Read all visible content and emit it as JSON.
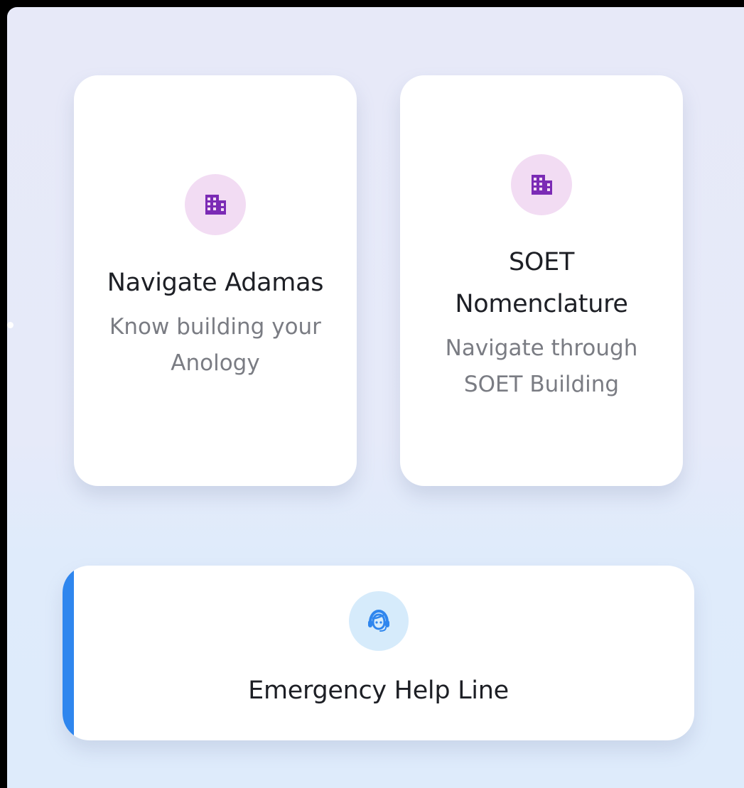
{
  "cards": [
    {
      "title": "Navigate Adamas",
      "subtitle": "Know building your Anology",
      "icon": "building-icon",
      "icon_color": "#7b2bb5",
      "icon_bg": "#f2dcf3"
    },
    {
      "title": "SOET Nomenclature",
      "subtitle": "Navigate through SOET Building",
      "icon": "building-icon",
      "icon_color": "#7b2bb5",
      "icon_bg": "#f2dcf3"
    }
  ],
  "help": {
    "title": "Emergency Help Line",
    "icon": "headset-support-icon",
    "icon_color": "#2f86ee",
    "icon_bg": "#d6ebfb",
    "accent_color": "#2f86ee"
  }
}
